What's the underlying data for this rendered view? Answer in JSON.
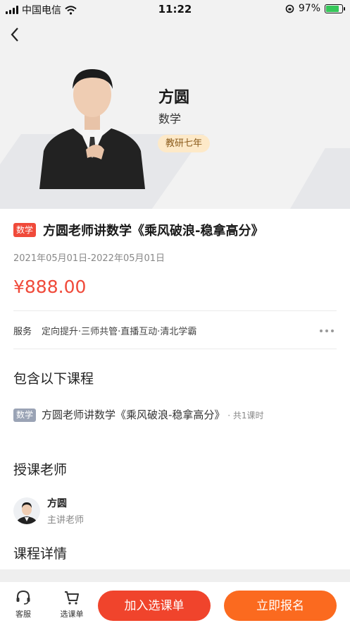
{
  "status_bar": {
    "carrier": "中国电信",
    "time": "11:22",
    "battery": "97%"
  },
  "teacher": {
    "name": "方圆",
    "subject": "数学",
    "badge": "教研七年"
  },
  "course": {
    "tag": "数学",
    "title": "方圆老师讲数学《乘风破浪-稳拿高分》",
    "date_range": "2021年05月01日-2022年05月01日",
    "price": "¥888.00",
    "service_label": "服务",
    "services": "定向提升·三师共管·直播互动·清北学霸"
  },
  "included": {
    "section_title": "包含以下课程",
    "tag": "数学",
    "title": "方圆老师讲数学《乘风破浪-稳拿高分》",
    "count": " · 共1课时"
  },
  "instructors": {
    "section_title": "授课老师",
    "name": "方圆",
    "role": "主讲老师"
  },
  "details": {
    "section_title": "课程详情"
  },
  "bottom_bar": {
    "service": "客服",
    "cart": "选课单",
    "add_button": "加入选课单",
    "enroll_button": "立即报名"
  },
  "colors": {
    "accent": "#f04a3a",
    "enroll": "#fb6a1f",
    "badge_bg": "#fde9c8"
  }
}
